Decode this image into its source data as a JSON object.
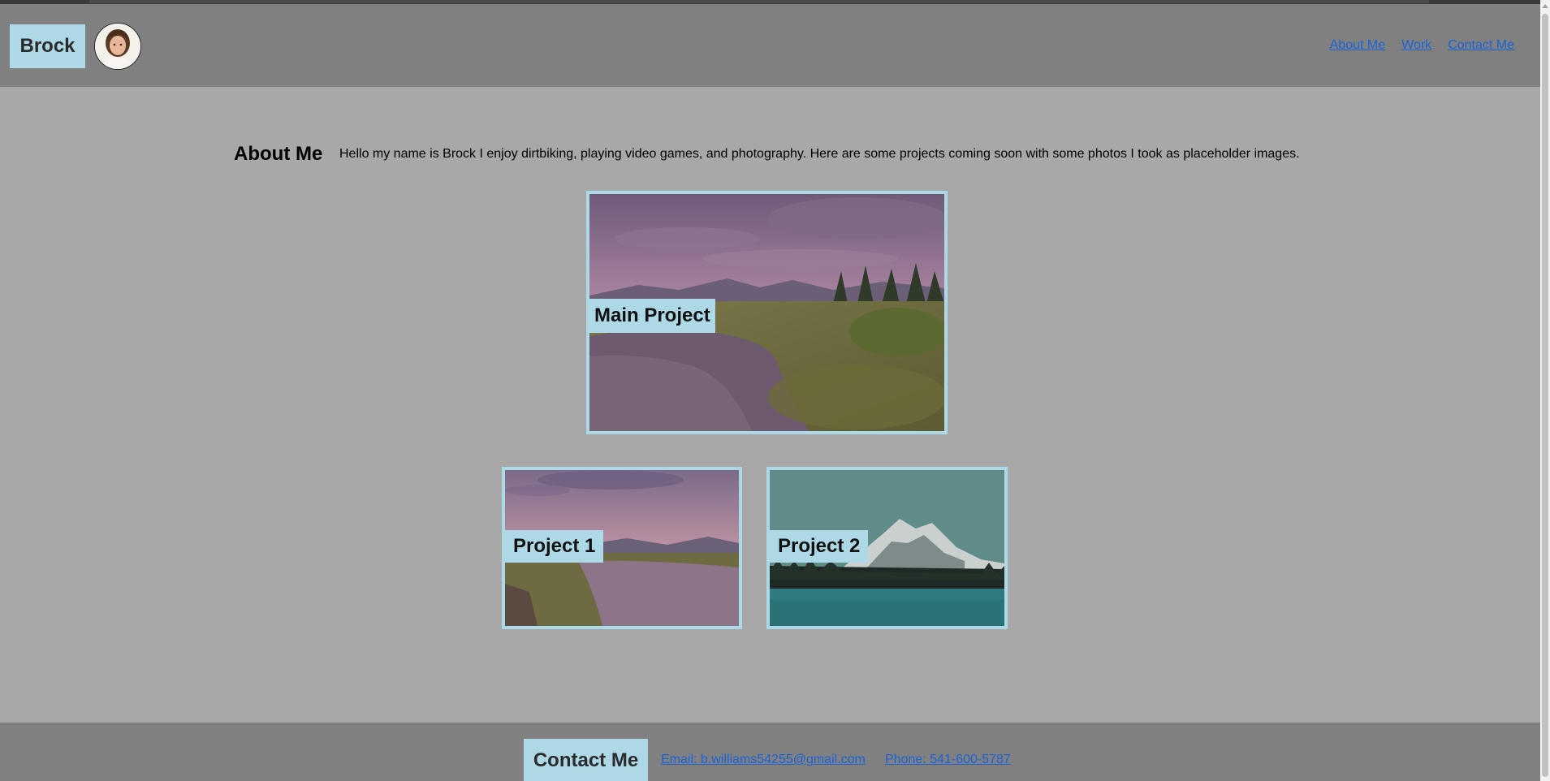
{
  "header": {
    "brand": "Brock",
    "nav": [
      {
        "label": "About Me"
      },
      {
        "label": "Work"
      },
      {
        "label": "Contact Me"
      }
    ]
  },
  "about": {
    "title": "About Me",
    "text": "Hello my name is Brock I enjoy dirtbiking, playing video games, and photography. Here are some projects coming soon with some photos I took as placeholder images."
  },
  "projects": {
    "main": "Main Project",
    "p1": "Project 1",
    "p2": "Project 2"
  },
  "footer": {
    "title": "Contact Me",
    "email": "Email: b.williams54255@gmail.com",
    "phone": "Phone: 541-600-5787"
  },
  "colors": {
    "accent": "#add8e6",
    "header_bg": "#808080",
    "page_bg": "#a8a8a8",
    "link": "#1a63d8"
  }
}
